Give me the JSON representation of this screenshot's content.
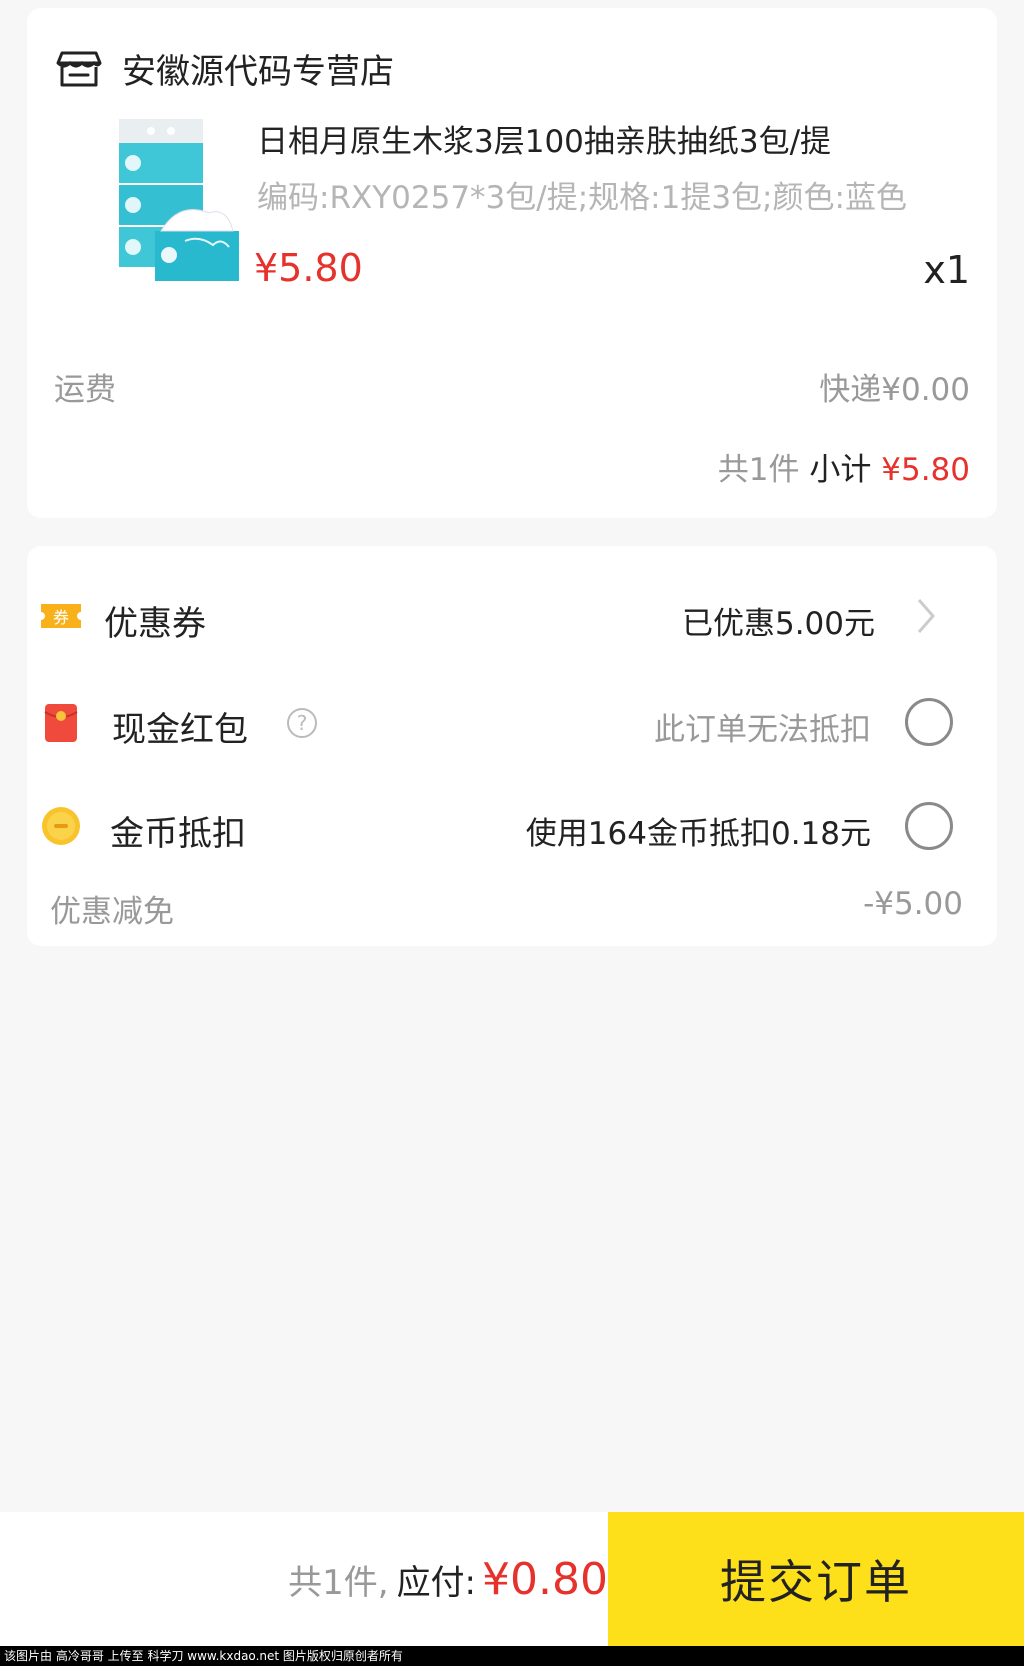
{
  "shop": {
    "icon": "store-icon",
    "name": "安徽源代码专营店"
  },
  "product": {
    "image": "tissue-pack-image",
    "title": "日相月原生木浆3层100抽亲肤抽纸3包/提",
    "spec": "编码:RXY0257*3包/提;规格:1提3包;颜色:蓝色",
    "price": "¥5.80",
    "quantity": "x1"
  },
  "shipping": {
    "label": "运费",
    "value": "快递¥0.00"
  },
  "subtotal": {
    "count": "共1件",
    "label": "小计",
    "amount": "¥5.80"
  },
  "discounts": {
    "coupon": {
      "icon": "coupon-icon",
      "label": "优惠券",
      "value": "已优惠5.00元"
    },
    "red_packet": {
      "icon": "red-packet-icon",
      "label": "现金红包",
      "help": "?",
      "value": "此订单无法抵扣",
      "selected": false
    },
    "coins": {
      "icon": "coin-icon",
      "label": "金币抵扣",
      "value": "使用164金币抵扣0.18元",
      "selected": false
    },
    "reduction": {
      "label": "优惠减免",
      "value": "-¥5.00"
    }
  },
  "footer": {
    "count": "共1件,",
    "label": "应付:",
    "amount": "¥0.80",
    "submit_label": "提交订单"
  },
  "watermark": "该图片由 高冷哥哥 上传至 科学刀 www.kxdao.net 图片版权归原创者所有",
  "colors": {
    "accent_red": "#e5322d",
    "submit_yellow": "#fde01a",
    "background": "#f7f7f7"
  }
}
